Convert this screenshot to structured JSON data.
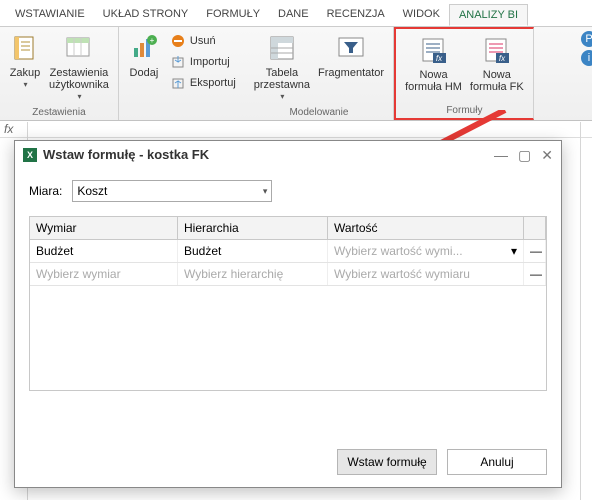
{
  "tabs": [
    "WSTAWIANIE",
    "UKŁAD STRONY",
    "FORMUŁY",
    "DANE",
    "RECENZJA",
    "WIDOK",
    "ANALIZY BI"
  ],
  "ribbon": {
    "g_zestawienia": "Zestawienia",
    "g_modelowanie": "Modelowanie",
    "g_formuly": "Formuły",
    "zakup": "Zakup",
    "zest_uzytk": "Zestawienia\nużytkownika",
    "dodaj": "Dodaj",
    "usun": "Usuń",
    "importuj": "Importuj",
    "eksportuj": "Eksportuj",
    "tabela": "Tabela\nprzestawna",
    "fragmentator": "Fragmentator",
    "nowa_hm": "Nowa\nformuła HM",
    "nowa_fk": "Nowa\nformuła FK"
  },
  "help": {
    "p": "P",
    "i": "i"
  },
  "fx_label": "fx",
  "dialog": {
    "title": "Wstaw formułę - kostka  FK",
    "miara_label": "Miara:",
    "miara_value": "Koszt",
    "col_wymiar": "Wymiar",
    "col_hier": "Hierarchia",
    "col_wart": "Wartość",
    "row1_wymiar": "Budżet",
    "row1_hier": "Budżet",
    "row1_wart_ph": "Wybierz wartość wymi...",
    "row2_wymiar_ph": "Wybierz wymiar",
    "row2_hier_ph": "Wybierz hierarchię",
    "row2_wart_ph": "Wybierz wartość wymiaru",
    "minus": "—",
    "btn_insert": "Wstaw formułę",
    "btn_cancel": "Anuluj"
  }
}
